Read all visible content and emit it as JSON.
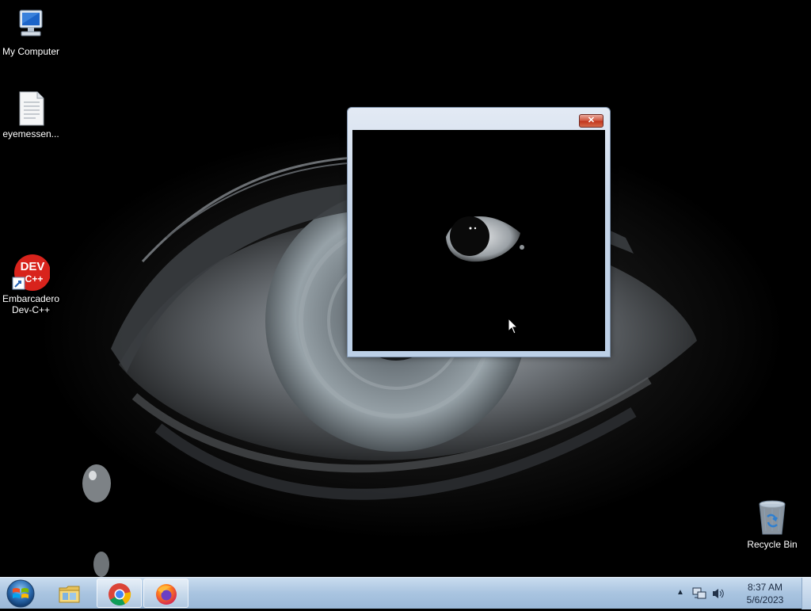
{
  "desktop": {
    "icons": [
      {
        "label": "My Computer",
        "icon": "computer-icon"
      },
      {
        "label": "eyemessen...",
        "icon": "text-file-icon"
      },
      {
        "label": "Embarcadero\nDev-C++",
        "icon": "devcpp-icon",
        "badge": "DEV",
        "badge_sub": "C++"
      },
      {
        "label": "Recycle Bin",
        "icon": "recycle-bin-icon"
      }
    ]
  },
  "window": {
    "title": "",
    "close_label": "✕"
  },
  "taskbar": {
    "start_icon": "windows-logo-icon",
    "pinned": [
      {
        "name": "file-explorer",
        "icon": "folder-icon"
      },
      {
        "name": "google-chrome",
        "icon": "chrome-icon"
      },
      {
        "name": "firefox",
        "icon": "firefox-icon"
      }
    ],
    "tray": {
      "icons": [
        "show-hidden-icons-arrow",
        "network-icon",
        "volume-icon"
      ],
      "time": "8:37 AM",
      "date": "5/6/2023"
    }
  },
  "colors": {
    "taskbar": "#a9c4e0",
    "close_button": "#c2361d",
    "chrome_red": "#db4437",
    "chrome_green": "#0f9d58",
    "chrome_yellow": "#f4b400",
    "chrome_blue": "#4285f4"
  }
}
